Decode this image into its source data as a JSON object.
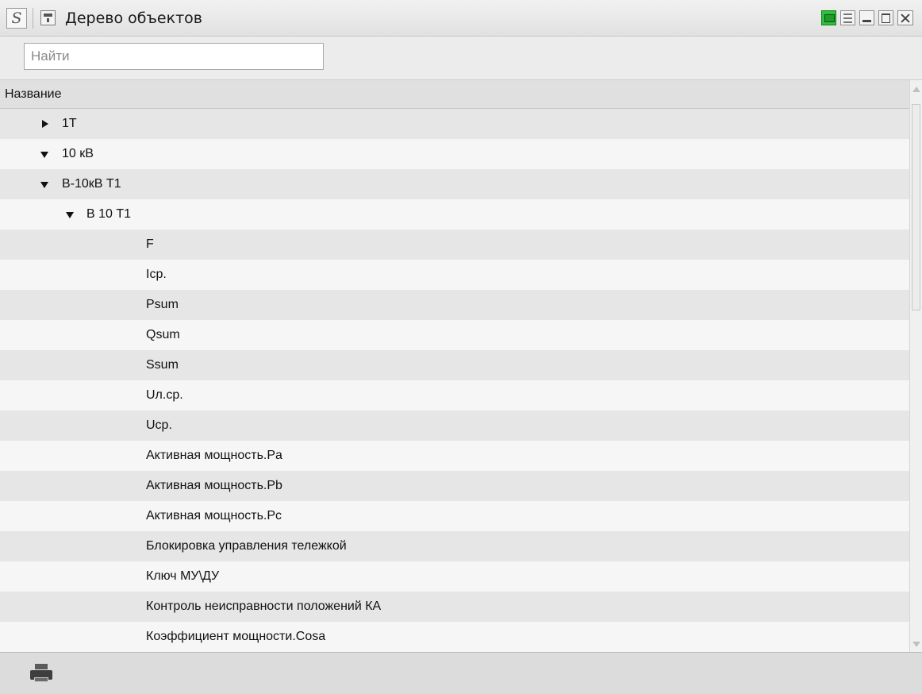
{
  "window": {
    "title": "Дерево объектов"
  },
  "search": {
    "placeholder": "Найти",
    "value": ""
  },
  "tree": {
    "column_header": "Название",
    "rows": [
      {
        "label": "1T",
        "level": 0,
        "expander": "collapsed"
      },
      {
        "label": "10 кВ",
        "level": 0,
        "expander": "expanded"
      },
      {
        "label": "В-10кВ Т1",
        "level": 1,
        "expander": "expanded"
      },
      {
        "label": "В 10 Т1",
        "level": 2,
        "expander": "expanded"
      },
      {
        "label": "F",
        "level": 3,
        "expander": "none"
      },
      {
        "label": "Iср.",
        "level": 3,
        "expander": "none"
      },
      {
        "label": "Psum",
        "level": 3,
        "expander": "none"
      },
      {
        "label": "Qsum",
        "level": 3,
        "expander": "none"
      },
      {
        "label": "Ssum",
        "level": 3,
        "expander": "none"
      },
      {
        "label": "Uл.ср.",
        "level": 3,
        "expander": "none"
      },
      {
        "label": "Uср.",
        "level": 3,
        "expander": "none"
      },
      {
        "label": "Активная мощность.Pa",
        "level": 3,
        "expander": "none"
      },
      {
        "label": "Активная мощность.Pb",
        "level": 3,
        "expander": "none"
      },
      {
        "label": "Активная мощность.Pc",
        "level": 3,
        "expander": "none"
      },
      {
        "label": "Блокировка  управления тележкой",
        "level": 3,
        "expander": "none"
      },
      {
        "label": "Ключ МУ\\ДУ",
        "level": 3,
        "expander": "none"
      },
      {
        "label": "Контроль неисправности  положений КА",
        "level": 3,
        "expander": "none"
      },
      {
        "label": "Коэффициент мощности.Cosa",
        "level": 3,
        "expander": "none"
      }
    ]
  },
  "titlebar_buttons": [
    {
      "name": "status-indicator-icon",
      "color": "#2fbf3c"
    },
    {
      "name": "collapse-panel-icon"
    },
    {
      "name": "minimize-icon"
    },
    {
      "name": "maximize-icon"
    },
    {
      "name": "close-icon"
    }
  ],
  "bottombar": {
    "icon": "printer-icon"
  }
}
